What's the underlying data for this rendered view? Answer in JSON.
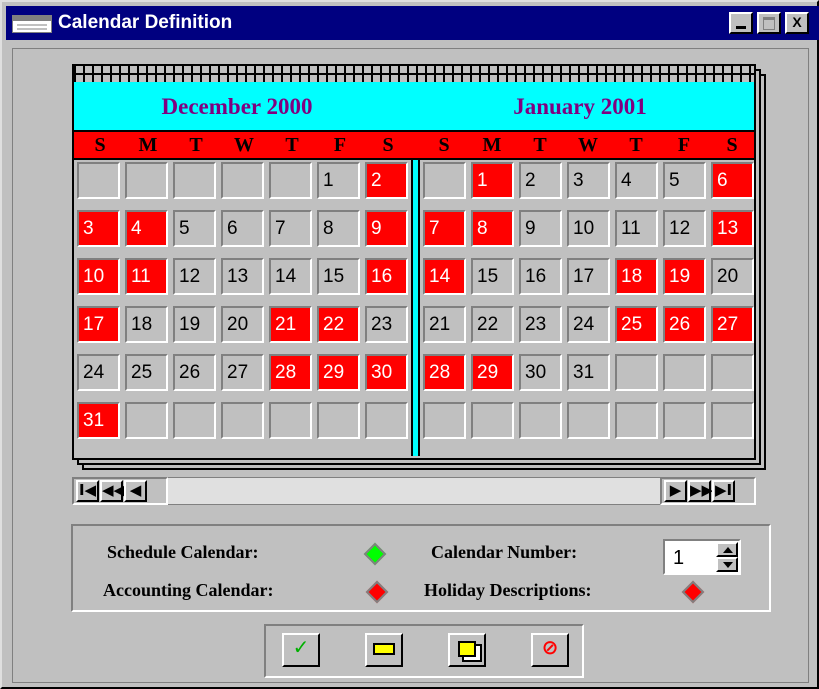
{
  "window": {
    "title": "Calendar Definition",
    "controls": [
      "_",
      "□",
      "X"
    ]
  },
  "months": [
    {
      "title": "December 2000",
      "weekdays": [
        "S",
        "M",
        "T",
        "W",
        "T",
        "F",
        "S"
      ],
      "days": [
        [
          "",
          "",
          "",
          "",
          "",
          "1",
          "2"
        ],
        [
          "3",
          "4",
          "5",
          "6",
          "7",
          "8",
          "9"
        ],
        [
          "10",
          "11",
          "12",
          "13",
          "14",
          "15",
          "16"
        ],
        [
          "17",
          "18",
          "19",
          "20",
          "21",
          "22",
          "23"
        ],
        [
          "24",
          "25",
          "26",
          "27",
          "28",
          "29",
          "30"
        ],
        [
          "31",
          "",
          "",
          "",
          "",
          "",
          ""
        ]
      ],
      "red": [
        "2",
        "3",
        "4",
        "9",
        "10",
        "11",
        "16",
        "17",
        "21",
        "22",
        "28",
        "29",
        "30",
        "31"
      ]
    },
    {
      "title": "January 2001",
      "weekdays": [
        "S",
        "M",
        "T",
        "W",
        "T",
        "F",
        "S"
      ],
      "days": [
        [
          "",
          "1",
          "2",
          "3",
          "4",
          "5",
          "6"
        ],
        [
          "7",
          "8",
          "9",
          "10",
          "11",
          "12",
          "13"
        ],
        [
          "14",
          "15",
          "16",
          "17",
          "18",
          "19",
          "20"
        ],
        [
          "21",
          "22",
          "23",
          "24",
          "25",
          "26",
          "27"
        ],
        [
          "28",
          "29",
          "30",
          "31",
          "",
          "",
          ""
        ],
        [
          "",
          "",
          "",
          "",
          "",
          "",
          ""
        ]
      ],
      "red": [
        "1",
        "6",
        "7",
        "8",
        "13",
        "14",
        "18",
        "19",
        "25",
        "26",
        "27",
        "28",
        "29"
      ]
    }
  ],
  "navigation": {
    "left": [
      "first-icon",
      "previous-page-icon",
      "previous-icon"
    ],
    "right": [
      "next-icon",
      "next-page-icon",
      "last-icon"
    ]
  },
  "settings": {
    "schedule_label": "Schedule Calendar:",
    "accounting_label": "Accounting Calendar:",
    "number_label": "Calendar Number:",
    "number_value": "1",
    "holiday_label": "Holiday Descriptions:",
    "schedule_color": "#00ff00",
    "accounting_color": "#ff0000",
    "holiday_color": "#ff0000"
  },
  "actions": [
    "checkmark-icon",
    "ruler-icon",
    "copy-icon",
    "cancel-icon"
  ],
  "colors": {
    "title_bar": "#000080",
    "month_header": "#00ffff",
    "weekday_bar": "#ff0000",
    "month_title": "#800080",
    "holiday_cell": "#ff0000",
    "window": "#c0c0c0"
  }
}
